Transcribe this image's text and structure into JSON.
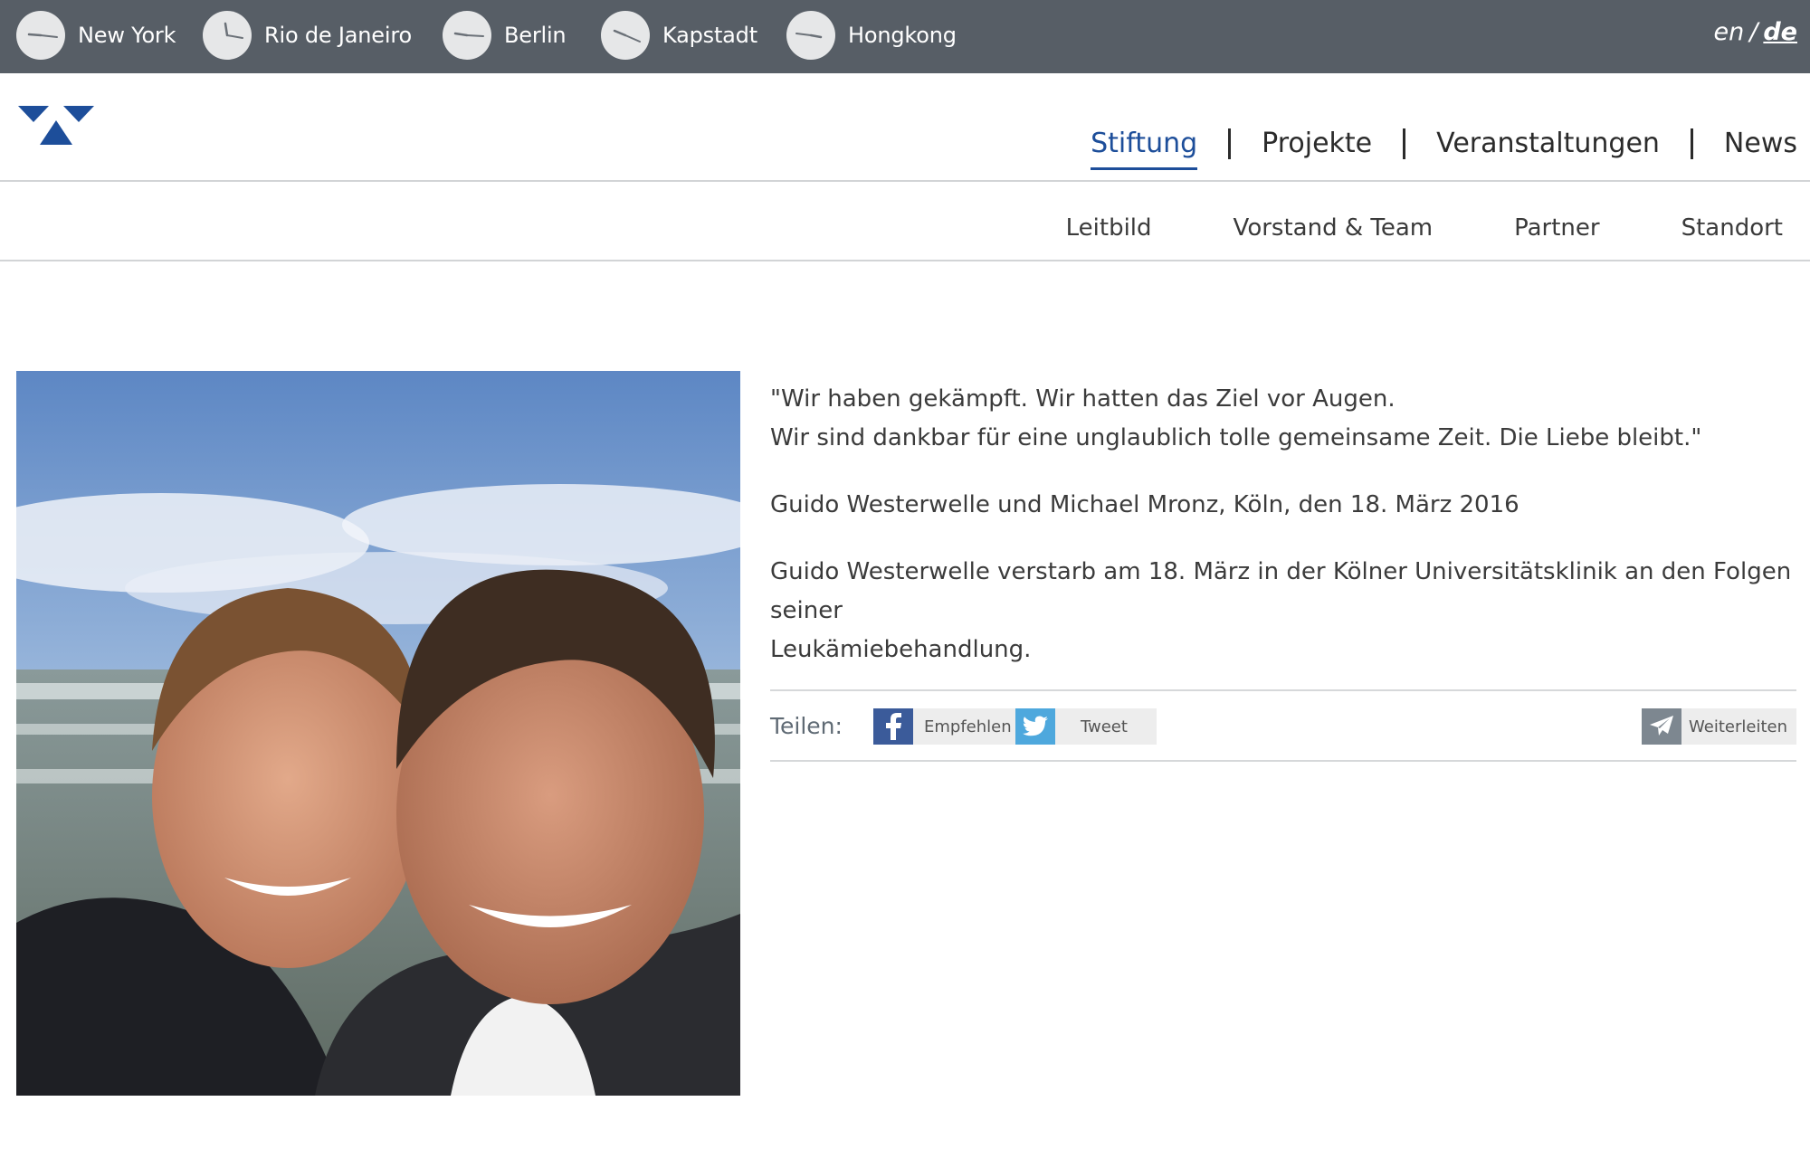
{
  "clocks": [
    {
      "city": "New York",
      "hour_angle": 270,
      "minute_angle": 90
    },
    {
      "city": "Rio de Janeiro",
      "hour_angle": 340,
      "minute_angle": 100
    },
    {
      "city": "Berlin",
      "hour_angle": 275,
      "minute_angle": 95
    },
    {
      "city": "Kapstadt",
      "hour_angle": 290,
      "minute_angle": 110
    },
    {
      "city": "Hongkong",
      "hour_angle": 100,
      "minute_angle": 250
    }
  ],
  "language": {
    "en": "en",
    "separator": "/",
    "de": "de",
    "active": "de"
  },
  "brand": {
    "accent": "#1d4e9a",
    "logo": "triangle-logo-icon"
  },
  "main_nav": [
    {
      "label": "Stiftung",
      "active": true
    },
    {
      "label": "Projekte",
      "active": false
    },
    {
      "label": "Veranstaltungen",
      "active": false
    },
    {
      "label": "News",
      "active": false
    }
  ],
  "sub_nav": [
    "Leitbild",
    "Vorstand & Team",
    "Partner",
    "Standort"
  ],
  "content": {
    "quote_line1": "\"Wir haben gekämpft. Wir hatten das Ziel vor Augen.",
    "quote_line2": "Wir sind dankbar für eine unglaublich tolle gemeinsame Zeit. Die Liebe bleibt.\"",
    "signature": "Guido Westerwelle und Michael Mronz, Köln, den 18. März 2016",
    "note_line1": "Guido Westerwelle verstarb am 18. März in der Kölner Universitätsklinik an den Folgen seiner",
    "note_line2": "Leukämiebehandlung."
  },
  "share": {
    "label": "Teilen:",
    "facebook": "Empfehlen",
    "twitter": "Tweet",
    "forward": "Weiterleiten"
  }
}
